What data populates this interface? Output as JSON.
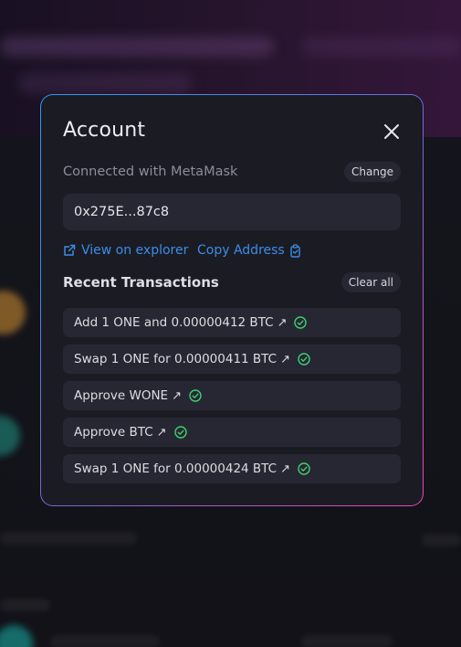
{
  "modal": {
    "title": "Account",
    "connected_text": "Connected with MetaMask",
    "change_label": "Change",
    "address": "0x275E...87c8",
    "view_on_explorer_label": "View on explorer",
    "copy_address_label": "Copy Address",
    "recent_transactions_title": "Recent Transactions",
    "clear_all_label": "Clear all",
    "transactions": [
      {
        "label": "Add 1 ONE and 0.00000412 BTC",
        "arrow": "↗",
        "status": "success"
      },
      {
        "label": "Swap 1 ONE for 0.00000411 BTC",
        "arrow": "↗",
        "status": "success"
      },
      {
        "label": "Approve WONE",
        "arrow": "↗",
        "status": "success"
      },
      {
        "label": "Approve BTC",
        "arrow": "↗",
        "status": "success"
      },
      {
        "label": "Swap 1 ONE for 0.00000424 BTC",
        "arrow": "↗",
        "status": "success"
      }
    ]
  },
  "colors": {
    "accent_link": "#3a8ee6",
    "success_green": "#3ecf6e",
    "border_gradient_start": "#2d9cf5",
    "border_gradient_end": "#f041b6",
    "modal_bg": "#1b1b24"
  },
  "icons": {
    "close": "close-icon",
    "external_link": "external-link-icon",
    "copy": "copy-icon",
    "status": "check-circle-icon"
  }
}
